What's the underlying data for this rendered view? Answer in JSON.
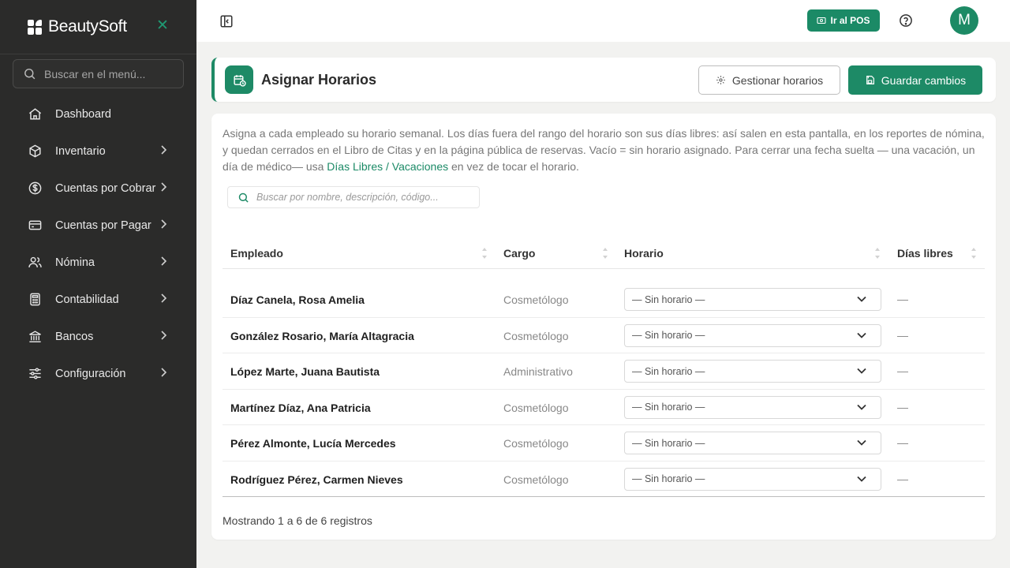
{
  "app": {
    "brand": "BeautySoft"
  },
  "sidebar": {
    "search_placeholder": "Buscar en el menú...",
    "items": [
      {
        "label": "Dashboard",
        "icon": "home-icon",
        "has_children": false
      },
      {
        "label": "Inventario",
        "icon": "box-icon",
        "has_children": true
      },
      {
        "label": "Cuentas por Cobrar",
        "icon": "dollar-circle-icon",
        "has_children": true
      },
      {
        "label": "Cuentas por Pagar",
        "icon": "credit-card-icon",
        "has_children": true
      },
      {
        "label": "Nómina",
        "icon": "users-icon",
        "has_children": true
      },
      {
        "label": "Contabilidad",
        "icon": "calculator-icon",
        "has_children": true
      },
      {
        "label": "Bancos",
        "icon": "bank-icon",
        "has_children": true
      },
      {
        "label": "Configuración",
        "icon": "sliders-icon",
        "has_children": true
      }
    ]
  },
  "topbar": {
    "pos_label": "Ir al POS",
    "avatar_initial": "M"
  },
  "header": {
    "title": "Asignar Horarios",
    "manage_label": "Gestionar horarios",
    "save_label": "Guardar cambios"
  },
  "main": {
    "description_pre": "Asigna a cada empleado su horario semanal. Los días fuera del rango del horario son sus días libres: así salen en esta pantalla, en los reportes de nómina, y quedan cerrados en el Libro de Citas y en la página pública de reservas. Vacío = sin horario asignado. Para cerrar una fecha suelta — una vacación, un día de médico— usa ",
    "description_link": "Días Libres / Vacaciones",
    "description_post": " en vez de tocar el horario.",
    "search_placeholder": "Buscar por nombre, descripción, código...",
    "columns": {
      "empleado": "Empleado",
      "cargo": "Cargo",
      "horario": "Horario",
      "dias_libres": "Días libres"
    },
    "rows": [
      {
        "empleado": "Díaz Canela, Rosa Amelia",
        "cargo": "Cosmetólogo",
        "horario": "— Sin horario —",
        "dias_libres": "—"
      },
      {
        "empleado": "González Rosario, María Altagracia",
        "cargo": "Cosmetólogo",
        "horario": "— Sin horario —",
        "dias_libres": "—"
      },
      {
        "empleado": "López Marte, Juana Bautista",
        "cargo": "Administrativo",
        "horario": "— Sin horario —",
        "dias_libres": "—"
      },
      {
        "empleado": "Martínez Díaz, Ana Patricia",
        "cargo": "Cosmetólogo",
        "horario": "— Sin horario —",
        "dias_libres": "—"
      },
      {
        "empleado": "Pérez Almonte, Lucía Mercedes",
        "cargo": "Cosmetólogo",
        "horario": "— Sin horario —",
        "dias_libres": "—"
      },
      {
        "empleado": "Rodríguez Pérez, Carmen Nieves",
        "cargo": "Cosmetólogo",
        "horario": "— Sin horario —",
        "dias_libres": "—"
      }
    ],
    "footer": "Mostrando 1 a 6 de 6 registros"
  },
  "colors": {
    "accent": "#1d8a66",
    "sidebar_bg": "#2b2b2a"
  }
}
